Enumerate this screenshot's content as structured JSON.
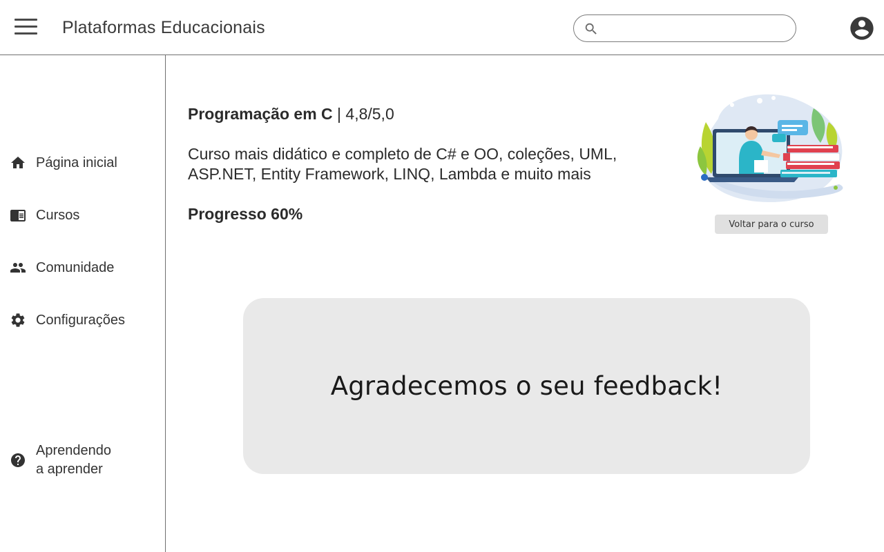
{
  "header": {
    "app_title": "Plataformas Educacionais",
    "search": {
      "value": "",
      "placeholder": ""
    }
  },
  "sidebar": {
    "items": [
      {
        "label": "Página inicial",
        "icon": "home-icon"
      },
      {
        "label": "Cursos",
        "icon": "courses-icon"
      },
      {
        "label": "Comunidade",
        "icon": "community-icon"
      },
      {
        "label": "Configurações",
        "icon": "settings-icon"
      }
    ],
    "help": {
      "line1": "Aprendendo",
      "line2": "a aprender",
      "icon": "help-icon"
    }
  },
  "course": {
    "name": "Programação em C",
    "separator": " | ",
    "rating": "4,8/5,0",
    "description": "Curso mais didático e completo de C# e OO, coleções, UML, ASP.NET, Entity Framework, LINQ, Lambda e muito mais",
    "progress_label": "Progresso 60%",
    "back_button": "Voltar para o curso"
  },
  "feedback": {
    "message": "Agradecemos o seu feedback!"
  },
  "colors": {
    "border": "#6f6f6f",
    "card_bg": "#e9e9e9",
    "button_bg": "#e0e0e0",
    "icon": "#333333",
    "illustration_teal": "#2bb5c8",
    "illustration_red": "#e0414f",
    "illustration_green": "#8cc63f"
  }
}
